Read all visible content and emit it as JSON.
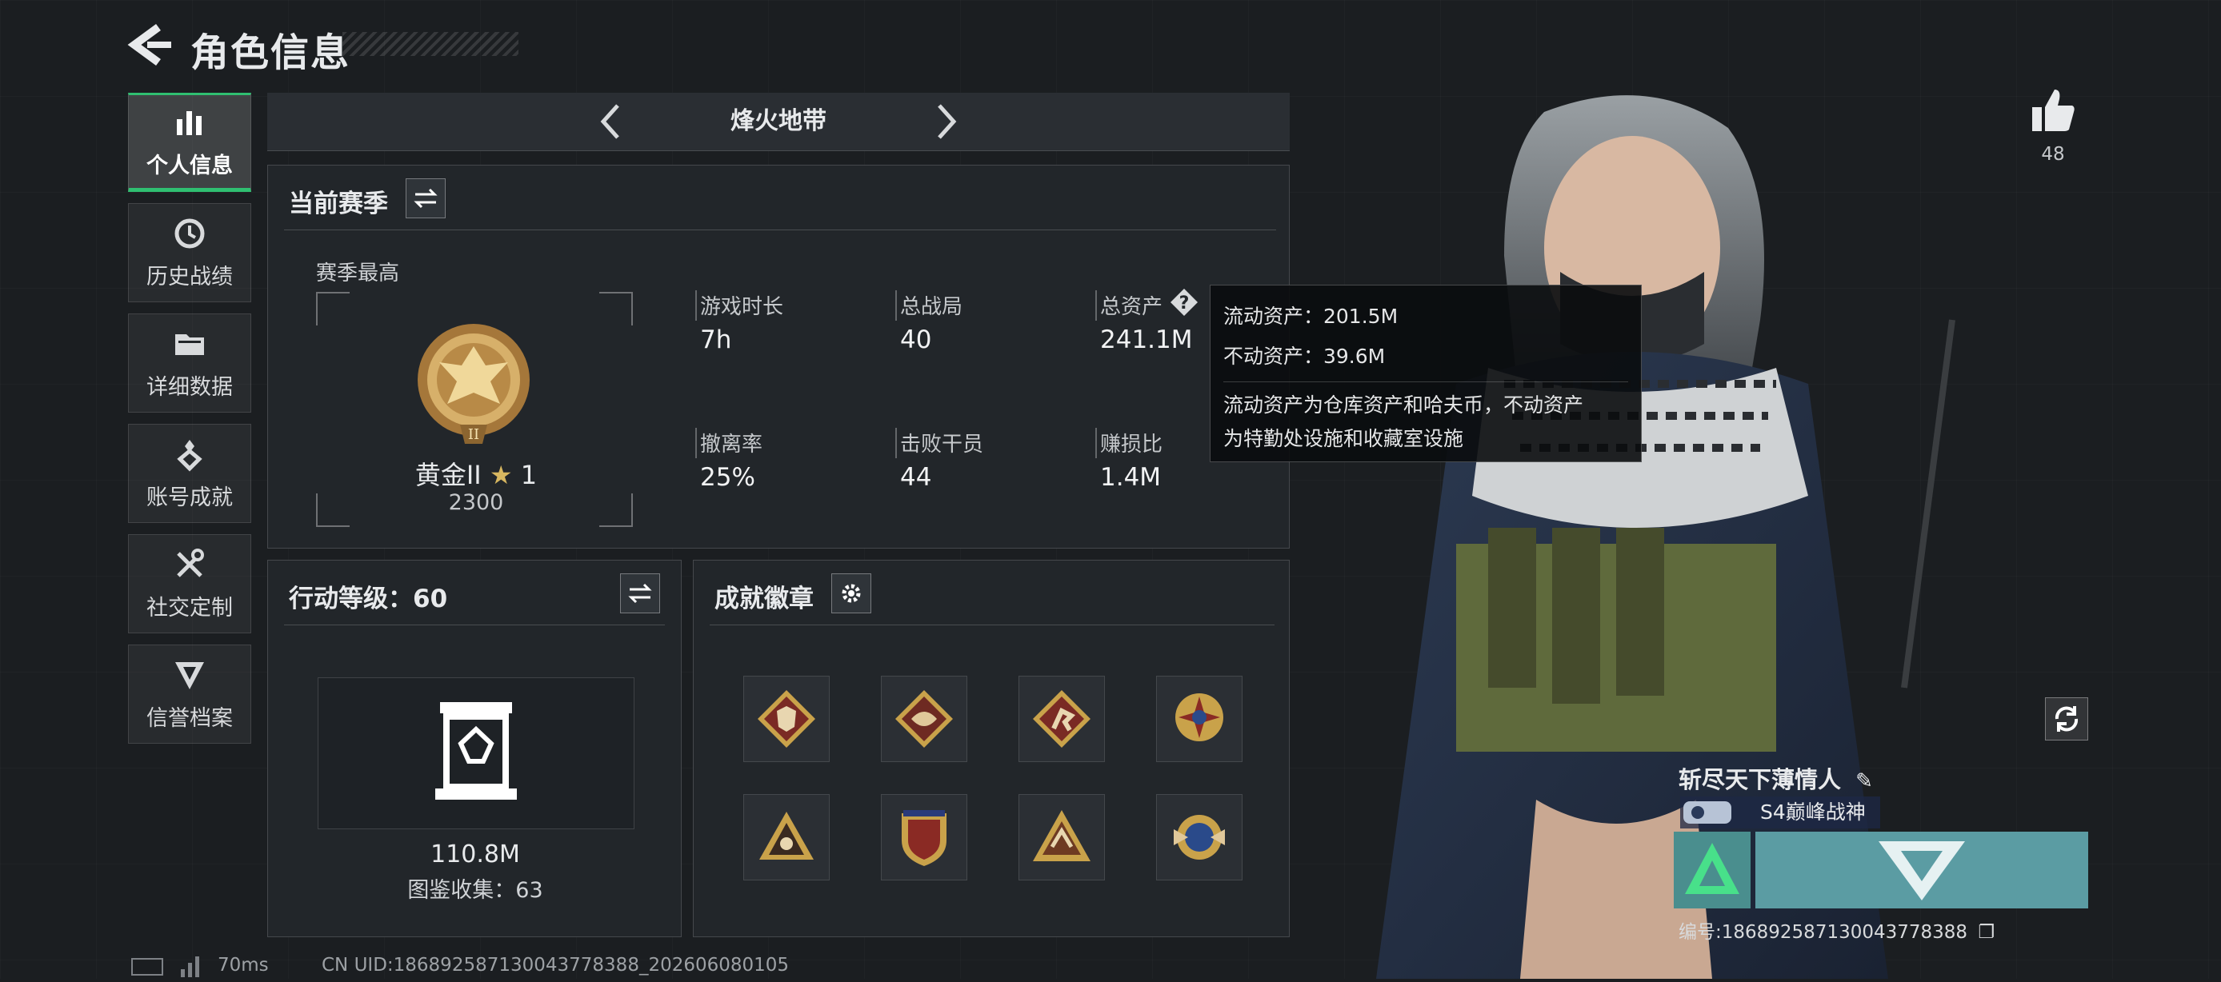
{
  "header": {
    "title": "角色信息"
  },
  "sidebar": {
    "items": [
      {
        "label": "个人信息",
        "icon": "bar-chart-icon",
        "active": true
      },
      {
        "label": "历史战绩",
        "icon": "clock-icon"
      },
      {
        "label": "详细数据",
        "icon": "folder-icon"
      },
      {
        "label": "账号成就",
        "icon": "medal-icon"
      },
      {
        "label": "社交定制",
        "icon": "tools-icon"
      },
      {
        "label": "信誉档案",
        "icon": "shield-icon"
      }
    ]
  },
  "mode": {
    "title": "烽火地带"
  },
  "season_panel": {
    "title": "当前赛季",
    "season_best_label": "赛季最高",
    "rank_name": "黄金II",
    "rank_stars": "1",
    "rank_score": "2300",
    "stats": [
      {
        "label": "游戏时长",
        "value": "7h"
      },
      {
        "label": "总战局",
        "value": "40"
      },
      {
        "label": "总资产",
        "value": "241.1M"
      },
      {
        "label": "撤离率",
        "value": "25%"
      },
      {
        "label": "击败干员",
        "value": "44"
      },
      {
        "label": "赚损比",
        "value": "1.4M"
      }
    ]
  },
  "tooltip": {
    "liquid": "流动资产：201.5M",
    "fixed": "不动资产：39.6M",
    "desc_line1": "流动资产为仓库资产和哈夫币，不动资产",
    "desc_line2": "为特勤处设施和收藏室设施"
  },
  "level_panel": {
    "title": "行动等级：60",
    "value": "110.8M",
    "collection": "图鉴收集：63"
  },
  "badge_panel": {
    "title": "成就徽章",
    "badges": [
      "wolf-badge-icon",
      "dragon-badge-icon",
      "runner-badge-icon",
      "cross-medal-icon",
      "triangle-badge-icon",
      "shield-emblem-icon",
      "eagle-triangle-icon",
      "wing-medal-icon"
    ]
  },
  "profile": {
    "likes": "48",
    "name": "斩尽天下薄情人",
    "title": "S4巅峰战神",
    "uid": "编号:1868925871300437783​88"
  },
  "footer": {
    "ping": "70ms",
    "cn_uid": "CN UID:186892587130043778388_202606080105"
  },
  "colors": {
    "accent_green": "#2fbf71",
    "gold": "#c9a24a",
    "rank_teal": "#5b9ca3"
  }
}
